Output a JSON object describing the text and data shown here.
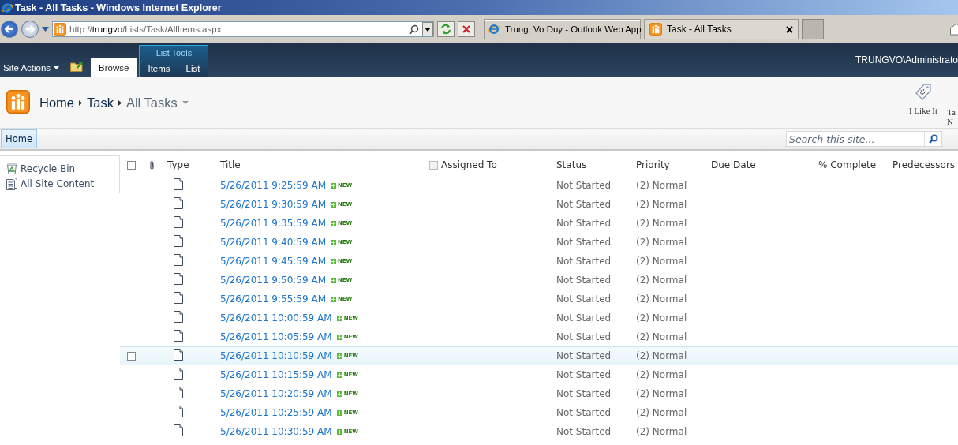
{
  "window": {
    "title": "Task - All Tasks - Windows Internet Explorer"
  },
  "address_bar": {
    "prefix": "http://",
    "host": "trungvo",
    "path": "/Lists/Task/AllItems.aspx"
  },
  "browser_tabs": [
    {
      "label": "Trung, Vo Duy - Outlook Web App",
      "selected": false
    },
    {
      "label": "Task - All Tasks",
      "selected": true
    }
  ],
  "ribbon": {
    "site_actions": "Site Actions",
    "context_group": "List Tools",
    "tabs": [
      {
        "label": "Browse",
        "selected": true
      },
      {
        "label": "Items",
        "selected": false
      },
      {
        "label": "List",
        "selected": false
      }
    ],
    "user": "TRUNGVO\\Administrato"
  },
  "breadcrumb": [
    "Home",
    "Task",
    "All Tasks"
  ],
  "ribbon_buttons": [
    {
      "label": "I Like It"
    },
    {
      "label": "Ta",
      "label_2": "N"
    }
  ],
  "top_nav": [
    {
      "label": "Home",
      "selected": true
    }
  ],
  "search": {
    "placeholder": "Search this site..."
  },
  "quick_launch": [
    {
      "label": "Recycle Bin",
      "kind": "recycle"
    },
    {
      "label": "All Site Content",
      "kind": "content"
    }
  ],
  "table": {
    "select_all_checked": false,
    "assigned_to_checked": false,
    "columns": [
      "Type",
      "Title",
      "Assigned To",
      "Status",
      "Priority",
      "Due Date",
      "% Complete",
      "Predecessors"
    ],
    "rows": [
      {
        "title": "5/26/2011 9:25:59 AM",
        "badge": "NEW",
        "status": "Not Started",
        "priority": "(2) Normal",
        "selected": false
      },
      {
        "title": "5/26/2011 9:30:59 AM",
        "badge": "NEW",
        "status": "Not Started",
        "priority": "(2) Normal",
        "selected": false
      },
      {
        "title": "5/26/2011 9:35:59 AM",
        "badge": "NEW",
        "status": "Not Started",
        "priority": "(2) Normal",
        "selected": false
      },
      {
        "title": "5/26/2011 9:40:59 AM",
        "badge": "NEW",
        "status": "Not Started",
        "priority": "(2) Normal",
        "selected": false
      },
      {
        "title": "5/26/2011 9:45:59 AM",
        "badge": "NEW",
        "status": "Not Started",
        "priority": "(2) Normal",
        "selected": false
      },
      {
        "title": "5/26/2011 9:50:59 AM",
        "badge": "NEW",
        "status": "Not Started",
        "priority": "(2) Normal",
        "selected": false
      },
      {
        "title": "5/26/2011 9:55:59 AM",
        "badge": "NEW",
        "status": "Not Started",
        "priority": "(2) Normal",
        "selected": false
      },
      {
        "title": "5/26/2011 10:00:59 AM",
        "badge": "NEW",
        "status": "Not Started",
        "priority": "(2) Normal",
        "selected": false
      },
      {
        "title": "5/26/2011 10:05:59 AM",
        "badge": "NEW",
        "status": "Not Started",
        "priority": "(2) Normal",
        "selected": false
      },
      {
        "title": "5/26/2011 10:10:59 AM",
        "badge": "NEW",
        "status": "Not Started",
        "priority": "(2) Normal",
        "selected": true
      },
      {
        "title": "5/26/2011 10:15:59 AM",
        "badge": "NEW",
        "status": "Not Started",
        "priority": "(2) Normal",
        "selected": false
      },
      {
        "title": "5/26/2011 10:20:59 AM",
        "badge": "NEW",
        "status": "Not Started",
        "priority": "(2) Normal",
        "selected": false
      },
      {
        "title": "5/26/2011 10:25:59 AM",
        "badge": "NEW",
        "status": "Not Started",
        "priority": "(2) Normal",
        "selected": false
      },
      {
        "title": "5/26/2011 10:30:59 AM",
        "badge": "NEW",
        "status": "Not Started",
        "priority": "(2) Normal",
        "selected": false
      }
    ]
  }
}
